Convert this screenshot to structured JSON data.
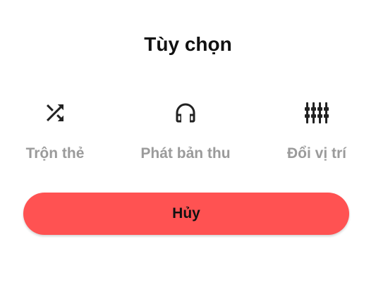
{
  "dialog": {
    "title": "Tùy chọn"
  },
  "options": [
    {
      "label": "Trộn thẻ",
      "icon": "shuffle-icon"
    },
    {
      "label": "Phát bản thu",
      "icon": "headphones-icon"
    },
    {
      "label": "Đổi vị trí",
      "icon": "equalizer-sliders-icon"
    }
  ],
  "cancel": {
    "label": "Hủy"
  },
  "colors": {
    "cancel_button": "#ff5252",
    "option_label": "#9b9b9b",
    "title": "#111111"
  }
}
